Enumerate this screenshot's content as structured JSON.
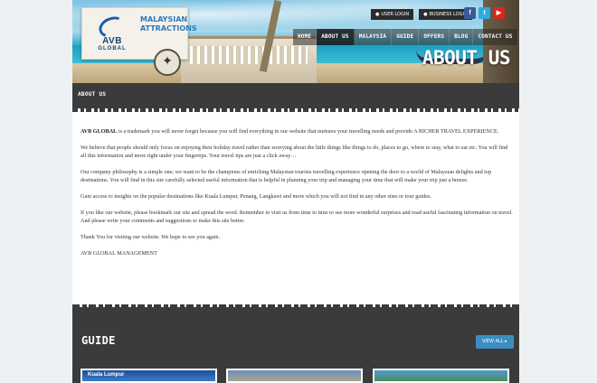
{
  "header": {
    "logo": {
      "brand": "AVB",
      "brand_sub": "GLOBAL",
      "tagline_line1": "MALAYSIAN",
      "tagline_line2": "ATTRACTIONS"
    },
    "top_buttons": [
      {
        "label": "USER LOGIN",
        "icon": "user-icon"
      },
      {
        "label": "BUSINESS LOGIN",
        "icon": "user-icon"
      }
    ],
    "social": [
      {
        "icon": "facebook-icon",
        "glyph": "f",
        "color": "#3b5998"
      },
      {
        "icon": "twitter-icon",
        "glyph": "t",
        "color": "#2fa9e0"
      },
      {
        "icon": "youtube-icon",
        "glyph": "▶",
        "color": "#d8261f"
      }
    ],
    "nav": [
      {
        "label": "HOME",
        "active": false
      },
      {
        "label": "ABOUT US",
        "active": true
      },
      {
        "label": "MALAYSIA",
        "active": false
      },
      {
        "label": "GUIDE",
        "active": false
      },
      {
        "label": "OFFERS",
        "active": false
      },
      {
        "label": "BLOG",
        "active": false
      },
      {
        "label": "CONTACT US",
        "active": false
      }
    ],
    "hero_title": "ABOUT US"
  },
  "section_bar": {
    "title": "ABOUT US"
  },
  "content": {
    "intro_bold": "AVB GLOBAL",
    "intro_rest": " is a trademark you will never forget because you will find everything in our website that nurtures your travelling needs and provide A RICHER TRAVEL EXPERIENCE.",
    "para2": "We believe that people should only focus on enjoying their holiday travel rather than worrying about the little things like things to do, places to go, where to stay, what to eat etc. You will find all this information and more right under your fingertips. Your travel tips are just a click away…",
    "para3": "Our company philosophy is a simple one; we want to be the champions of enriching Malaysian tourists travelling experience opening the door to a world of Malaysian delights and top destinations. You will find in this site carefully selected useful information that is helpful in planning your trip and managing your time that will make your trip just a breeze.",
    "para4": "Gain access to insights on the popular destinations like Kuala Lumpur, Penang, Langkawi and more which you will not find in any other sites or tour guides.",
    "para5": "If you like our website, please bookmark our site and spread the word. Remember to visit us from time to time to see more wonderful surprises and read useful fascinating information on travel. And please write your comments and suggestions to make this site better.",
    "para6": "Thank You for visiting our website. We hope to see you again.",
    "signoff": "AVB GLOBAL MANAGEMENT"
  },
  "guide": {
    "title": "GUIDE",
    "view_all": "VIEW ALL ▸",
    "thumbs": [
      {
        "caption": "Kuala Lumpur"
      },
      {
        "caption": ""
      },
      {
        "caption": ""
      }
    ]
  }
}
